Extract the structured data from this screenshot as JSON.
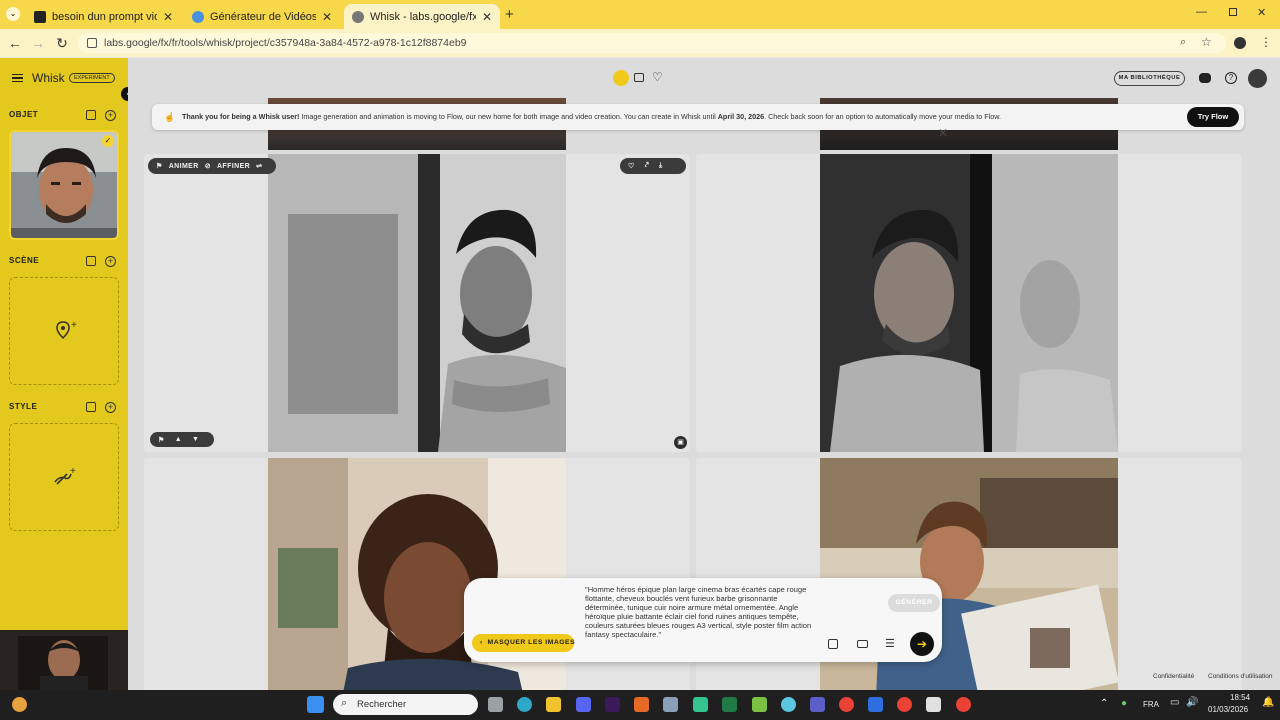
{
  "browser": {
    "tabs": [
      {
        "label": "besoin dun prompt video pour",
        "favicon": "chatgpt-icon",
        "color": "#222"
      },
      {
        "label": "Générateur de Vidéos IA - Créé",
        "favicon": "gen-icon",
        "color": "#4a90e2"
      },
      {
        "label": "Whisk - labs.google/fx",
        "favicon": "whisk-icon",
        "color": "#777"
      }
    ],
    "url": "labs.google/fx/fr/tools/whisk/project/c357948a-3a84-4572-a978-1c12f8874eb9"
  },
  "app": {
    "name": "Whisk",
    "badge": "EXPERIMENT",
    "library_button": "MA BIBLIOTHÈQUE"
  },
  "sidebar": {
    "sections": [
      {
        "title": "OBJET"
      },
      {
        "title": "SCÈNE"
      },
      {
        "title": "STYLE"
      }
    ]
  },
  "banner": {
    "lead": "Thank you for being a Whisk user!",
    "body": " Image generation and animation is moving to Flow, our new home for both image and video creation. You can create in Whisk until ",
    "date": "April 30, 2026",
    "tail": ". Check back soon for an option to automatically move your media to Flow.",
    "button": "Try Flow"
  },
  "card": {
    "animate": "ANIMER",
    "refine": "AFFINER"
  },
  "prompt": {
    "text": "\"Homme héros épique plan large cinema bras écartés cape rouge flottante, cheveux bouclés vent furieux barbe grisonnante déterminée, tunique cuir noire armure métal ornementée. Angle héroïque pluie battante éclair ciel fond ruines antiques tempête, couleurs saturées bleues rouges A3 vertical, style poster film action fantasy spectaculaire.\"",
    "generate": "GÉNÉRER",
    "hide_images": "MASQUER LES IMAGES"
  },
  "footer": {
    "privacy": "Confidentialité",
    "terms": "Conditions d'utilisation"
  },
  "taskbar": {
    "search": "Rechercher",
    "lang": "FRA",
    "time": "18:54",
    "date": "01/03/2026"
  },
  "colors": {
    "accent": "#e3c81e",
    "tabbar": "#f6d84a"
  }
}
